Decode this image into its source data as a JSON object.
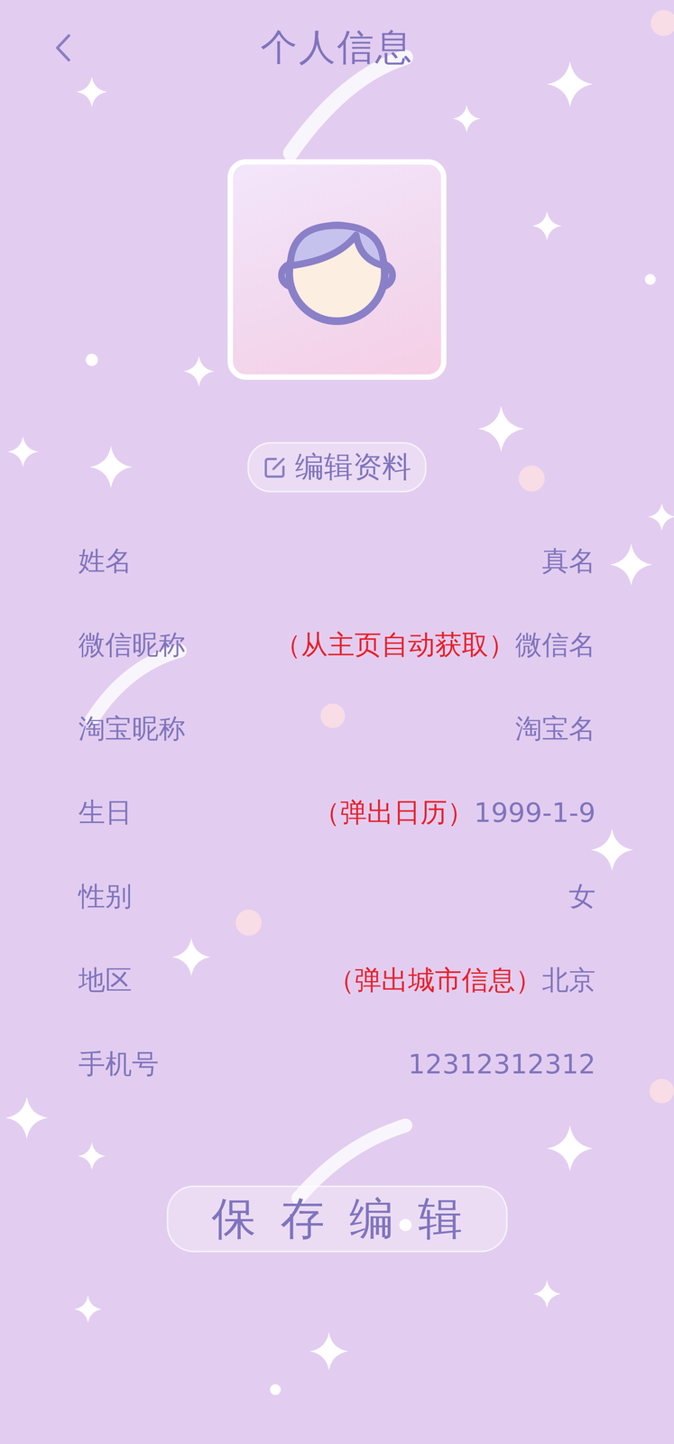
{
  "header": {
    "title": "个人信息"
  },
  "edit_button": {
    "label": "编辑资料"
  },
  "fields": [
    {
      "label": "姓名",
      "value": "真名"
    },
    {
      "label": "微信昵称",
      "value": "微信名",
      "hint": "（从主页自动获取）"
    },
    {
      "label": "淘宝昵称",
      "value": "淘宝名"
    },
    {
      "label": "生日",
      "value": "1999-1-9",
      "hint": "（弹出日历）"
    },
    {
      "label": "性别",
      "value": "女"
    },
    {
      "label": "地区",
      "value": "北京",
      "hint": "（弹出城市信息）"
    },
    {
      "label": "手机号",
      "value": "12312312312"
    }
  ],
  "save_button": {
    "label": "保存编辑"
  }
}
